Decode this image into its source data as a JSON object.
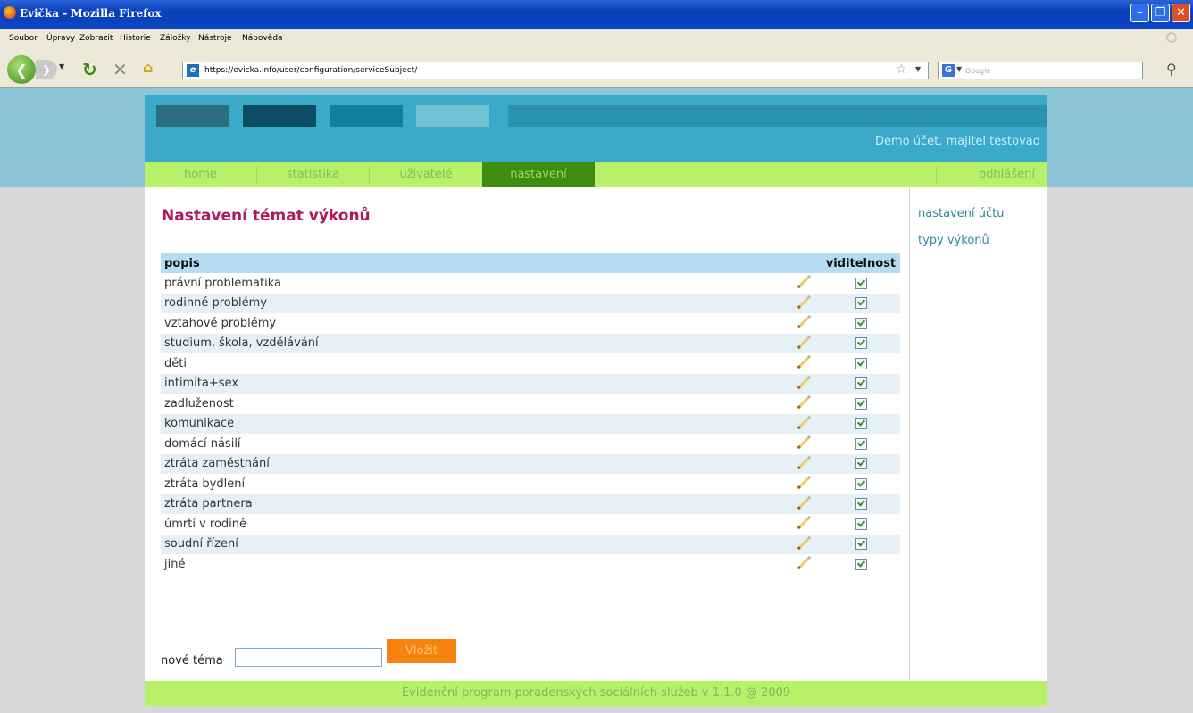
{
  "window": {
    "title": "Evička - Mozilla Firefox"
  },
  "menu": [
    "Soubor",
    "Úpravy",
    "Zobrazit",
    "Historie",
    "Záložky",
    "Nástroje",
    "Nápověda"
  ],
  "browser": {
    "url": "https://evicka.info/user/configuration/serviceSubject/",
    "search_placeholder": "Google"
  },
  "header": {
    "user_info": "Demo účet, majitel testovad"
  },
  "nav": {
    "tabs": [
      "home",
      "statistika",
      "uživatelé",
      "nastavení"
    ],
    "active": "nastavení",
    "logout": "odhlášení"
  },
  "main": {
    "title": "Nastavení témat výkonů",
    "table": {
      "col_desc": "popis",
      "col_visibility": "viditelnost",
      "rows": [
        {
          "label": "právní problematika",
          "visible": true
        },
        {
          "label": "rodinné problémy",
          "visible": true
        },
        {
          "label": "vztahové problémy",
          "visible": true
        },
        {
          "label": "studium, škola, vzdělávání",
          "visible": true
        },
        {
          "label": "děti",
          "visible": true
        },
        {
          "label": "intimita+sex",
          "visible": true
        },
        {
          "label": "zadluženost",
          "visible": true
        },
        {
          "label": "komunikace",
          "visible": true
        },
        {
          "label": "domácí násilí",
          "visible": true
        },
        {
          "label": "ztráta zaměstnání",
          "visible": true
        },
        {
          "label": "ztráta bydlení",
          "visible": true
        },
        {
          "label": "ztráta partnera",
          "visible": true
        },
        {
          "label": "úmrtí v rodině",
          "visible": true
        },
        {
          "label": "soudní řízení",
          "visible": true
        },
        {
          "label": "jiné",
          "visible": true
        }
      ]
    },
    "new_topic_label": "nové téma",
    "new_topic_value": "",
    "insert_button": "Vložit"
  },
  "sidebar": {
    "links": [
      "nastavení účtu",
      "typy výkonů"
    ]
  },
  "footer": {
    "text": "Evidenční program poradenských sociálních služeb v 1.1.0 @ 2009"
  }
}
